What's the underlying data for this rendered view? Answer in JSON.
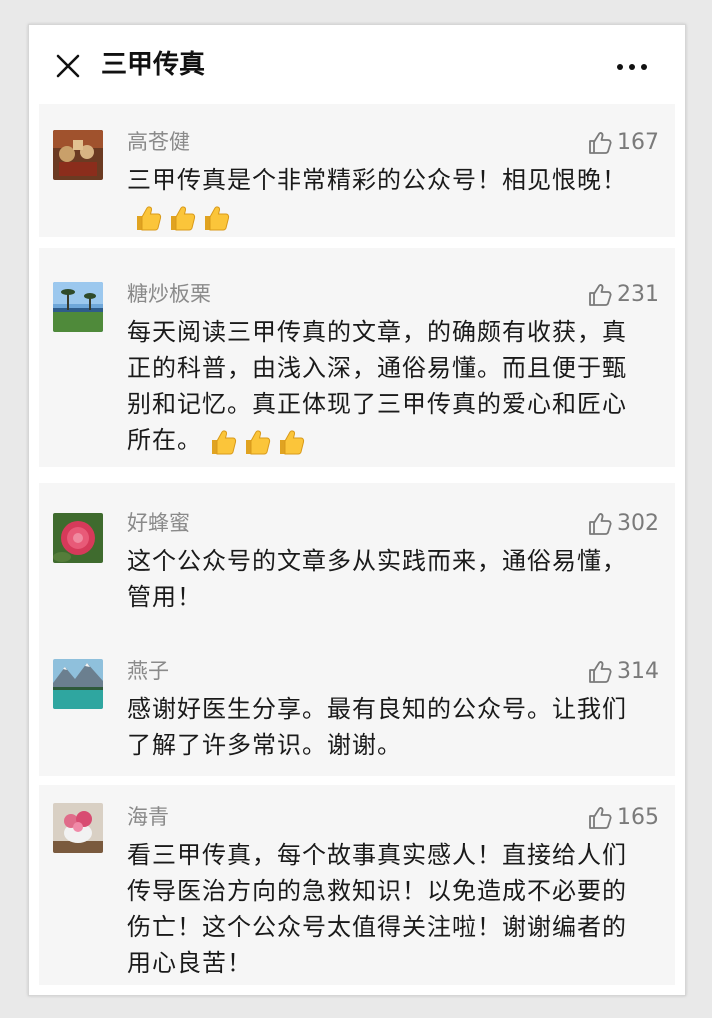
{
  "header": {
    "title": "三甲传真",
    "close_icon": "close-icon",
    "more_icon": "more-icon"
  },
  "comments": [
    {
      "name": "高苍健",
      "likes": "167",
      "text": "三甲传真是个非常精彩的公众号！相见恨晚！",
      "emoji": "thumbs-up-emoji",
      "emoji_count": 3
    },
    {
      "name": "糖炒板栗",
      "likes": "231",
      "text": "每天阅读三甲传真的文章，的确颇有收获，真正的科普，由浅入深，通俗易懂。而且便于甄别和记忆。真正体现了三甲传真的爱心和匠心所在。",
      "emoji": "thumbs-up-emoji",
      "emoji_count": 3
    },
    {
      "name": "好蜂蜜",
      "likes": "302",
      "text": "这个公众号的文章多从实践而来，通俗易懂，管用！"
    },
    {
      "name": "燕子",
      "likes": "314",
      "text": "感谢好医生分享。最有良知的公众号。让我们了解了许多常识。谢谢。"
    },
    {
      "name": "海青",
      "likes": "165",
      "text": "看三甲传真，每个故事真实感人！直接给人们传导医治方向的急救知识！以免造成不必要的伤亡！这个公众号太值得关注啦！谢谢编者的用心良苦！"
    }
  ],
  "icons": {
    "like": "thumbs-up-outline-icon"
  },
  "colors": {
    "card_background": "#f6f6f6",
    "name_text": "#8a8a8a",
    "body_text": "#1a1a1a"
  }
}
